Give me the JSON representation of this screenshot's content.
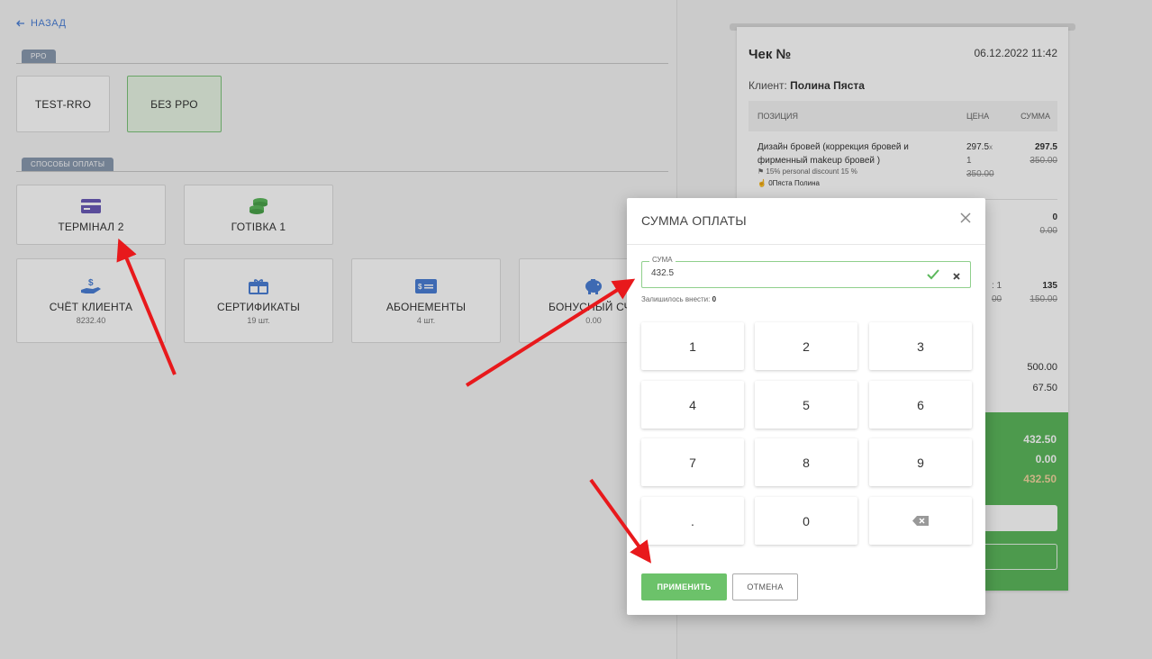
{
  "nav": {
    "back_label": "НАЗАД"
  },
  "rro": {
    "section_label": "РРО",
    "options": [
      "TEST-RRO",
      "БЕЗ РРО"
    ]
  },
  "payment": {
    "section_label": "СПОСОБЫ ОПЛАТЫ",
    "methods": [
      {
        "label": "ТЕРМІНАЛ 2",
        "icon": "credit-card-icon"
      },
      {
        "label": "ГОТІВКА 1",
        "icon": "coins-icon"
      },
      {
        "label": "СЧЁТ КЛИЕНТА",
        "sub": "8232.40",
        "icon": "money-hand-icon"
      },
      {
        "label": "СЕРТИФИКАТЫ",
        "sub": "19 шт.",
        "icon": "gift-card-icon"
      },
      {
        "label": "АБОНЕМЕНТЫ",
        "sub": "4 шт.",
        "icon": "ticket-card-icon"
      },
      {
        "label": "БОНУСНЫЙ СЧЁ",
        "sub": "0.00",
        "icon": "piggy-bank-icon"
      }
    ]
  },
  "receipt": {
    "title": "Чек №",
    "date": "06.12.2022 11:42",
    "client_label": "Клиент:",
    "client_name": "Полина Пяста",
    "columns": [
      "ПОЗИЦИЯ",
      "ЦЕНА",
      "СУММА"
    ],
    "item": {
      "name_line1": "Дизайн бровей (коррекция бровей и",
      "name_line2": "фирменный makeup бровей )",
      "discount": "15% personal discount 15 %",
      "master": "0Пяста Полина",
      "price": "297.5",
      "price_x": "x",
      "qty": "1",
      "price_old": "350.00",
      "sum": "297.5",
      "sum_old": "350.00"
    },
    "item2": {
      "sum": "0",
      "sum_old": "0.00"
    },
    "item3": {
      "qty": ": 1",
      "price_old": "00",
      "sum": "135",
      "sum_old": "150.00"
    },
    "totals": {
      "subtotal": "500.00",
      "discount": "67.50"
    },
    "summary": {
      "to_pay": "432.50",
      "paid": "0.00",
      "remaining": "432.50"
    },
    "colors": {
      "green": "#5cb85c",
      "remaining": "#f3d6a0"
    }
  },
  "modal": {
    "title": "СУММА ОПЛАТЫ",
    "field_label": "СУМА",
    "field_value": "432.5",
    "remain_label": "Залишилось внести:",
    "remain_value": "0",
    "keys": [
      "1",
      "2",
      "3",
      "4",
      "5",
      "6",
      "7",
      "8",
      "9",
      ".",
      "0",
      "backspace"
    ],
    "apply_label": "ПРИМЕНИТЬ",
    "cancel_label": "ОТМЕНА"
  }
}
